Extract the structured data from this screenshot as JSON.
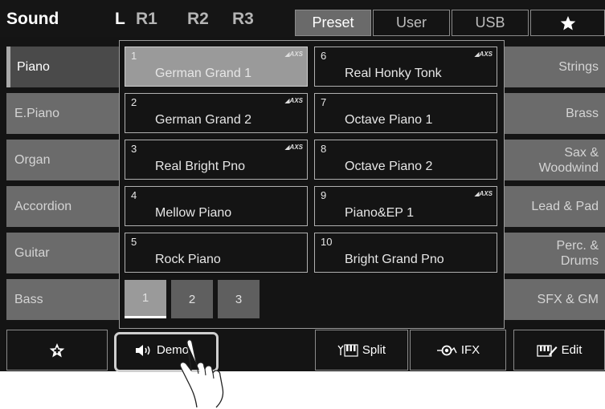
{
  "header": {
    "title": "Sound",
    "keyboard_parts": [
      "L",
      "R1",
      "R2",
      "R3"
    ],
    "tabs": [
      "Preset",
      "User",
      "USB"
    ],
    "active_tab": "Preset"
  },
  "left_categories": [
    "Piano",
    "E.Piano",
    "Organ",
    "Accordion",
    "Guitar",
    "Bass"
  ],
  "right_categories": [
    "Strings",
    "Brass",
    "Sax &\nWoodwind",
    "Lead & Pad",
    "Perc. &\nDrums",
    "SFX & GM"
  ],
  "voices": [
    {
      "num": "1",
      "name": "German Grand 1",
      "axs": "AXS"
    },
    {
      "num": "2",
      "name": "German Grand 2",
      "axs": "AXS"
    },
    {
      "num": "3",
      "name": "Real Bright Pno",
      "axs": "AXS"
    },
    {
      "num": "4",
      "name": "Mellow Piano",
      "axs": ""
    },
    {
      "num": "5",
      "name": "Rock Piano",
      "axs": ""
    },
    {
      "num": "6",
      "name": "Real Honky Tonk",
      "axs": "AXS"
    },
    {
      "num": "7",
      "name": "Octave Piano 1",
      "axs": ""
    },
    {
      "num": "8",
      "name": "Octave Piano 2",
      "axs": ""
    },
    {
      "num": "9",
      "name": "Piano&EP 1",
      "axs": "AXS"
    },
    {
      "num": "10",
      "name": "Bright Grand Pno",
      "axs": ""
    }
  ],
  "pages": [
    "1",
    "2",
    "3"
  ],
  "bottom": {
    "demo_label": "Demo",
    "split_label": "Split",
    "ifx_label": "IFX",
    "edit_label": "Edit"
  },
  "colors": {
    "background": "#141414",
    "selected_voice": "#9a9a9a",
    "category_button": "#6b6b6b"
  }
}
